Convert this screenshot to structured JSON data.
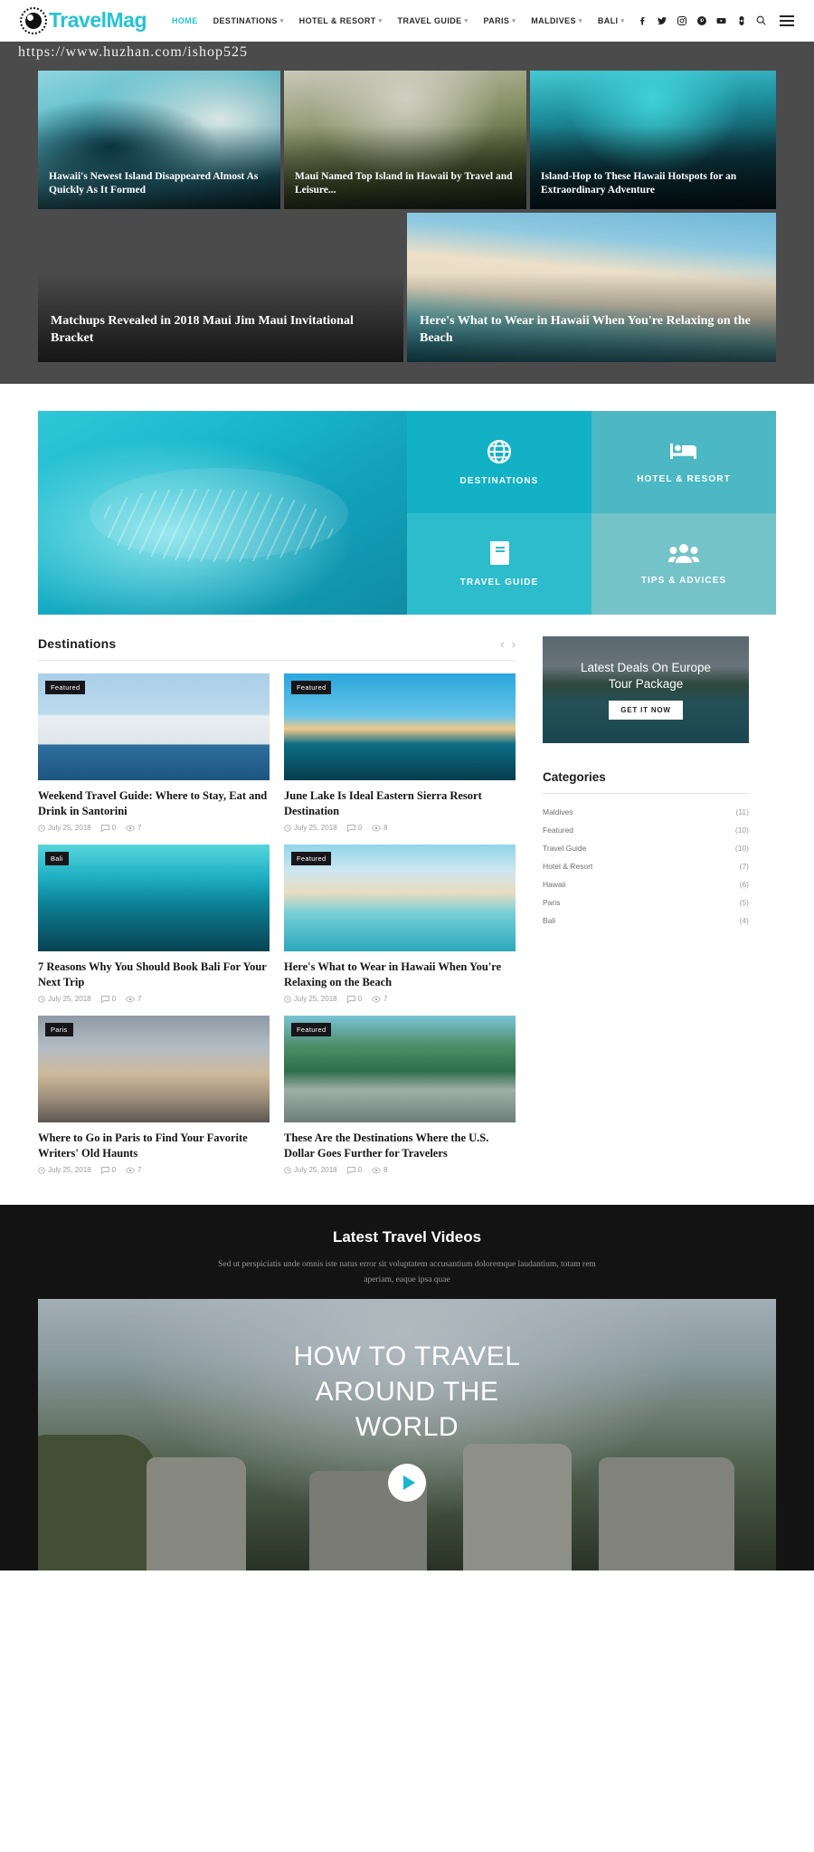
{
  "header": {
    "logo_text_1": "Travel",
    "logo_text_2": "Mag",
    "nav": [
      {
        "label": "HOME",
        "caret": false,
        "active": true
      },
      {
        "label": "DESTINATIONS",
        "caret": true,
        "active": false
      },
      {
        "label": "HOTEL & RESORT",
        "caret": true,
        "active": false
      },
      {
        "label": "TRAVEL GUIDE",
        "caret": true,
        "active": false
      },
      {
        "label": "PARIS",
        "caret": true,
        "active": false
      },
      {
        "label": "MALDIVES",
        "caret": true,
        "active": false
      },
      {
        "label": "BALI",
        "caret": true,
        "active": false
      }
    ],
    "social": [
      "facebook-icon",
      "twitter-icon",
      "instagram-icon",
      "pinterest-icon",
      "youtube-icon",
      "vimeo-icon"
    ],
    "search_icon": "search-icon",
    "menu_icon": "hamburger-icon"
  },
  "url_bar": {
    "url": "https://www.huzhan.com/ishop525"
  },
  "hero": {
    "row1": [
      {
        "title": "Hawaii's Newest Island Disappeared Almost As Quickly As It Formed",
        "image": "surfer-in-wave"
      },
      {
        "title": "Maui Named Top Island in Hawaii by Travel and Leisure...",
        "image": "mountain-ridge-hike"
      },
      {
        "title": "Island-Hop to These Hawaii Hotspots for an Extraordinary Adventure",
        "image": "turquoise-reef"
      }
    ],
    "row2": [
      {
        "title": "Matchups Revealed in 2018 Maui Jim Maui Invitational Bracket",
        "image": "coastal-palms"
      },
      {
        "title": "Here's What to Wear in Hawaii When You're Relaxing on the Beach",
        "image": "white-sand-beach"
      }
    ]
  },
  "services": {
    "photo_alt": "overwater-bungalows-aerial",
    "tiles": [
      {
        "label": "DESTINATIONS",
        "icon": "globe-icon",
        "color": "#12b1c6"
      },
      {
        "label": "HOTEL & RESORT",
        "icon": "bed-icon",
        "color": "#4cb8c4"
      },
      {
        "label": "TRAVEL GUIDE",
        "icon": "book-icon",
        "color": "#2dbccb"
      },
      {
        "label": "TIPS & ADVICES",
        "icon": "people-icon",
        "color": "#74c3c9"
      }
    ]
  },
  "destinations": {
    "section_title": "Destinations",
    "prev_icon": "chevron-left-icon",
    "next_icon": "chevron-right-icon",
    "cards": [
      {
        "badge": "Featured",
        "title": "Weekend Travel Guide: Where to Stay, Eat and Drink in Santorini",
        "date": "July 25, 2018",
        "comments": "0",
        "views": "7",
        "image": "santorini-whitewash-cliffs"
      },
      {
        "badge": "Featured",
        "title": "June Lake Is Ideal Eastern Sierra Resort Destination",
        "date": "July 25, 2018",
        "comments": "0",
        "views": "8",
        "image": "pier-huts-at-dusk"
      },
      {
        "badge": "Bali",
        "title": "7 Reasons Why You Should Book Bali For Your Next Trip",
        "date": "July 25, 2018",
        "comments": "0",
        "views": "7",
        "image": "turquoise-island-aerial"
      },
      {
        "badge": "Featured",
        "title": "Here's What to Wear in Hawaii When You're Relaxing on the Beach",
        "date": "July 25, 2018",
        "comments": "0",
        "views": "7",
        "image": "palm-lined-beach"
      },
      {
        "badge": "Paris",
        "title": "Where to Go in Paris to Find Your Favorite Writers' Old Haunts",
        "date": "July 25, 2018",
        "comments": "0",
        "views": "7",
        "image": "louvre-pyramid"
      },
      {
        "badge": "Featured",
        "title": "These Are the Destinations Where the U.S. Dollar Goes Further for Travelers",
        "date": "July 25, 2018",
        "comments": "0",
        "views": "8",
        "image": "resort-pool-palms"
      }
    ]
  },
  "sidebar": {
    "deal": {
      "title": "Latest Deals On Europe Tour Package",
      "button": "GET IT NOW",
      "image": "green-mountain-bay"
    },
    "categories_title": "Categories",
    "categories": [
      {
        "label": "Maldives",
        "count": "(11)"
      },
      {
        "label": "Featured",
        "count": "(10)"
      },
      {
        "label": "Travel Guide",
        "count": "(10)"
      },
      {
        "label": "Hotel & Resort",
        "count": "(7)"
      },
      {
        "label": "Hawaii",
        "count": "(6)"
      },
      {
        "label": "Paris",
        "count": "(5)"
      },
      {
        "label": "Bali",
        "count": "(4)"
      }
    ]
  },
  "videos": {
    "title": "Latest Travel Videos",
    "subtitle": "Sed ut perspiciatis unde omnis iste natus error sit voluptatem accusantium doloremque laudantium, totam rem aperiam, eaque ipsa quae",
    "video_text_line1": "HOW TO TRAVEL",
    "video_text_line2": "AROUND THE",
    "video_text_line3": "WORLD",
    "play_icon": "play-icon",
    "image": "meteora-cliffs-couple"
  },
  "colors": {
    "brand": "#25c3d6",
    "tile_1": "#12b1c6",
    "tile_2": "#4cb8c4",
    "tile_3": "#2dbccb",
    "tile_4": "#74c3c9",
    "dark_bg": "#131313",
    "url_bar_bg": "#4b4b4b"
  }
}
